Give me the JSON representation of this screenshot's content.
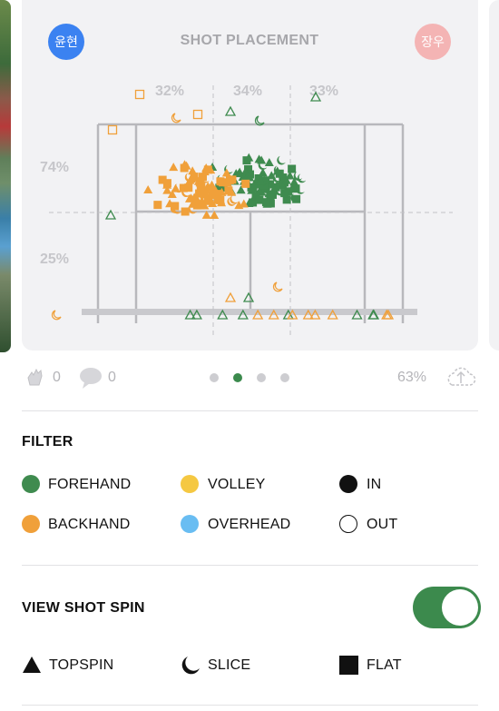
{
  "colors": {
    "forehand": "#3f8b4f",
    "backhand": "#f0a03a",
    "volley": "#f5c842",
    "overhead": "#69bdf2",
    "accent": "#3c8a4d",
    "player_left": "#3b82f1",
    "player_right": "#f4b4b4"
  },
  "card": {
    "title": "SHOT PLACEMENT",
    "player_left": "윤현",
    "player_right": "장우",
    "top_pcts": [
      "32%",
      "34%",
      "33%"
    ],
    "side_pcts": [
      "74%",
      "25%"
    ]
  },
  "footer": {
    "claps_count": "0",
    "comments_count": "0",
    "page_dots": 4,
    "active_dot": 1,
    "percent": "63%"
  },
  "filter": {
    "title": "FILTER",
    "items": [
      {
        "label": "FOREHAND",
        "icon": "green-dot"
      },
      {
        "label": "VOLLEY",
        "icon": "yellow-dot"
      },
      {
        "label": "IN",
        "icon": "filled-black-dot"
      },
      {
        "label": "BACKHAND",
        "icon": "orange-dot"
      },
      {
        "label": "OVERHEAD",
        "icon": "blue-dot"
      },
      {
        "label": "OUT",
        "icon": "hollow-dot"
      }
    ]
  },
  "spin": {
    "title": "VIEW SHOT SPIN",
    "toggle_on": true,
    "legend": [
      {
        "label": "TOPSPIN",
        "icon": "triangle-icon"
      },
      {
        "label": "SLICE",
        "icon": "crescent-icon"
      },
      {
        "label": "FLAT",
        "icon": "square-icon"
      }
    ]
  }
}
